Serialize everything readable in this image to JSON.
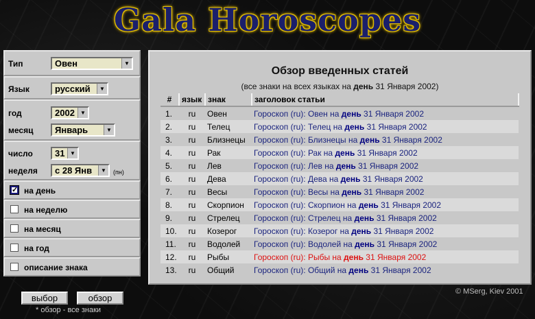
{
  "logo": "Gala Horoscopes",
  "form": {
    "type_label": "Тип",
    "type_value": "Овен",
    "lang_label": "Язык",
    "lang_value": "русский",
    "year_label": "год",
    "year_value": "2002",
    "month_label": "месяц",
    "month_value": "Январь",
    "day_label": "число",
    "day_value": "31",
    "week_label": "неделя",
    "week_value": "с 28 Янв",
    "week_note": "(пн)"
  },
  "options": [
    {
      "label": "на день",
      "checked": true
    },
    {
      "label": "на неделю",
      "checked": false
    },
    {
      "label": "на месяц",
      "checked": false
    },
    {
      "label": "на год",
      "checked": false
    },
    {
      "label": "описание знака",
      "checked": false
    }
  ],
  "buttons": {
    "select": "выбор",
    "overview": "обзор"
  },
  "note": "* обзор - все знаки",
  "credit": "© MSerg, Kiev 2001",
  "main": {
    "title": "Обзор введенных статей",
    "sub_pre": "(все знаки на всех языках на ",
    "sub_bold": "день",
    "sub_post": " 31 Января 2002)",
    "headers": [
      "#",
      "язык",
      "знак",
      "заголовок статьи"
    ],
    "rows": [
      {
        "n": "1.",
        "lang": "ru",
        "sign": "Овен",
        "pre": "Гороскоп (ru): Овен на ",
        "b": "день",
        "post": " 31 Января 2002"
      },
      {
        "n": "2.",
        "lang": "ru",
        "sign": "Телец",
        "pre": "Гороскоп (ru): Телец на ",
        "b": "день",
        "post": " 31 Января 2002"
      },
      {
        "n": "3.",
        "lang": "ru",
        "sign": "Близнецы",
        "pre": "Гороскоп (ru): Близнецы на ",
        "b": "день",
        "post": " 31 Января 2002"
      },
      {
        "n": "4.",
        "lang": "ru",
        "sign": "Рак",
        "pre": "Гороскоп (ru): Рак на ",
        "b": "день",
        "post": " 31 Января 2002"
      },
      {
        "n": "5.",
        "lang": "ru",
        "sign": "Лев",
        "pre": "Гороскоп (ru): Лев на ",
        "b": "день",
        "post": " 31 Января 2002"
      },
      {
        "n": "6.",
        "lang": "ru",
        "sign": "Дева",
        "pre": "Гороскоп (ru): Дева на ",
        "b": "день",
        "post": " 31 Января 2002"
      },
      {
        "n": "7.",
        "lang": "ru",
        "sign": "Весы",
        "pre": "Гороскоп (ru): Весы на ",
        "b": "день",
        "post": " 31 Января 2002"
      },
      {
        "n": "8.",
        "lang": "ru",
        "sign": "Скорпион",
        "pre": "Гороскоп (ru): Скорпион на ",
        "b": "день",
        "post": " 31 Января 2002"
      },
      {
        "n": "9.",
        "lang": "ru",
        "sign": "Стрелец",
        "pre": "Гороскоп (ru): Стрелец на ",
        "b": "день",
        "post": " 31 Января 2002"
      },
      {
        "n": "10.",
        "lang": "ru",
        "sign": "Козерог",
        "pre": "Гороскоп (ru): Козерог на ",
        "b": "день",
        "post": " 31 Января 2002"
      },
      {
        "n": "11.",
        "lang": "ru",
        "sign": "Водолей",
        "pre": "Гороскоп (ru): Водолей на ",
        "b": "день",
        "post": " 31 Января 2002"
      },
      {
        "n": "12.",
        "lang": "ru",
        "sign": "Рыбы",
        "pre": "Гороскоп (ru): Рыбы на ",
        "b": "день",
        "post": " 31 Января 2002"
      },
      {
        "n": "13.",
        "lang": "ru",
        "sign": "Общий",
        "pre": "Гороскоп (ru): Общий на ",
        "b": "день",
        "post": " 31 Января 2002"
      }
    ],
    "highlighted_row": 11,
    "link_color": "#1a237e",
    "highlight_color": "#dd1111"
  }
}
